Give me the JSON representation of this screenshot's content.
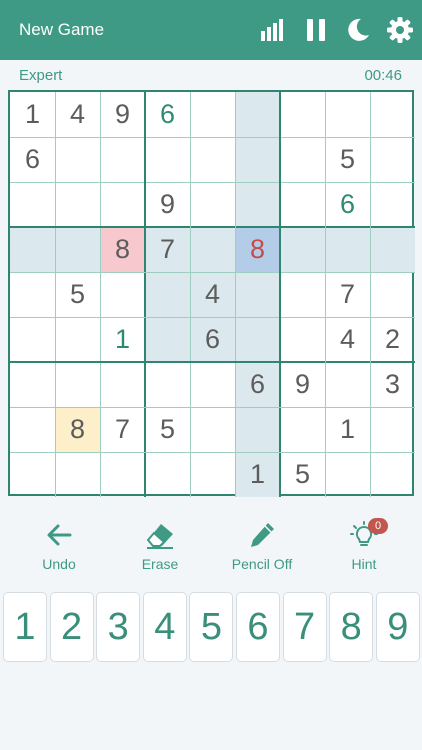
{
  "header": {
    "title": "New Game",
    "icons": [
      "stats-icon",
      "pause-icon",
      "moon-icon",
      "gear-icon"
    ]
  },
  "status": {
    "difficulty": "Expert",
    "timer": "00:46"
  },
  "board": {
    "selected": {
      "row": 3,
      "col": 5
    },
    "cells": [
      {
        "r": 0,
        "c": 0,
        "v": "1",
        "t": "given"
      },
      {
        "r": 0,
        "c": 1,
        "v": "4",
        "t": "given"
      },
      {
        "r": 0,
        "c": 2,
        "v": "9",
        "t": "given"
      },
      {
        "r": 0,
        "c": 3,
        "v": "6",
        "t": "user"
      },
      {
        "r": 1,
        "c": 0,
        "v": "6",
        "t": "given"
      },
      {
        "r": 1,
        "c": 7,
        "v": "5",
        "t": "given"
      },
      {
        "r": 2,
        "c": 3,
        "v": "9",
        "t": "given"
      },
      {
        "r": 2,
        "c": 7,
        "v": "6",
        "t": "user"
      },
      {
        "r": 3,
        "c": 2,
        "v": "8",
        "t": "given"
      },
      {
        "r": 3,
        "c": 3,
        "v": "7",
        "t": "given"
      },
      {
        "r": 3,
        "c": 5,
        "v": "8",
        "t": "err"
      },
      {
        "r": 4,
        "c": 1,
        "v": "5",
        "t": "given"
      },
      {
        "r": 4,
        "c": 4,
        "v": "4",
        "t": "given"
      },
      {
        "r": 4,
        "c": 7,
        "v": "7",
        "t": "given"
      },
      {
        "r": 5,
        "c": 2,
        "v": "1",
        "t": "user"
      },
      {
        "r": 5,
        "c": 4,
        "v": "6",
        "t": "given"
      },
      {
        "r": 5,
        "c": 7,
        "v": "4",
        "t": "given"
      },
      {
        "r": 5,
        "c": 8,
        "v": "2",
        "t": "given"
      },
      {
        "r": 6,
        "c": 5,
        "v": "6",
        "t": "given"
      },
      {
        "r": 6,
        "c": 6,
        "v": "9",
        "t": "given"
      },
      {
        "r": 6,
        "c": 8,
        "v": "3",
        "t": "given"
      },
      {
        "r": 7,
        "c": 1,
        "v": "8",
        "t": "given"
      },
      {
        "r": 7,
        "c": 2,
        "v": "7",
        "t": "given"
      },
      {
        "r": 7,
        "c": 3,
        "v": "5",
        "t": "given"
      },
      {
        "r": 7,
        "c": 7,
        "v": "1",
        "t": "given"
      },
      {
        "r": 8,
        "c": 5,
        "v": "1",
        "t": "given"
      },
      {
        "r": 8,
        "c": 6,
        "v": "5",
        "t": "given"
      }
    ],
    "highlights": {
      "conflict": [
        {
          "r": 3,
          "c": 2
        }
      ],
      "same_digit": [
        {
          "r": 7,
          "c": 1
        }
      ]
    },
    "colors": {
      "peer": "#dbe8ee",
      "selected": "#b3cde9",
      "conflict": "#f7c9cf",
      "same_digit": "#fcefc9",
      "accent": "#3e9a85"
    }
  },
  "actions": {
    "undo": "Undo",
    "erase": "Erase",
    "pencil": "Pencil Off",
    "hint": "Hint",
    "hint_count": "0"
  },
  "keypad": [
    "1",
    "2",
    "3",
    "4",
    "5",
    "6",
    "7",
    "8",
    "9"
  ]
}
